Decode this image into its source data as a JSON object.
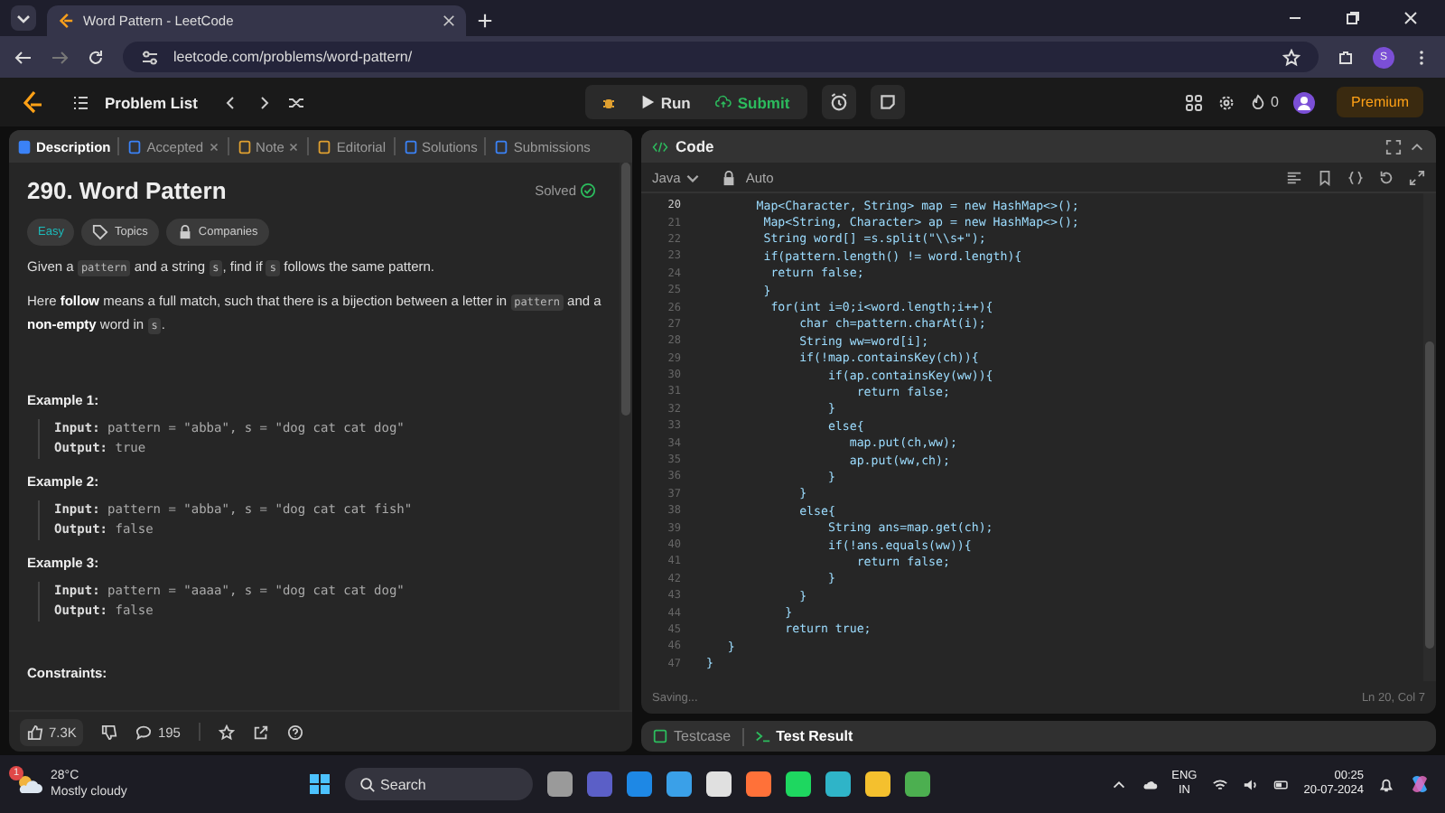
{
  "browser": {
    "tab_title": "Word Pattern - LeetCode",
    "url": "leetcode.com/problems/word-pattern/",
    "profile": "S"
  },
  "nav": {
    "problem_list": "Problem List",
    "run": "Run",
    "submit": "Submit",
    "streak": "0",
    "premium": "Premium"
  },
  "left_tabs": [
    {
      "label": "Description",
      "selected": true,
      "closable": false
    },
    {
      "label": "Accepted",
      "selected": false,
      "closable": true
    },
    {
      "label": "Note",
      "selected": false,
      "closable": true
    },
    {
      "label": "Editorial",
      "selected": false,
      "closable": false
    },
    {
      "label": "Solutions",
      "selected": false,
      "closable": false
    },
    {
      "label": "Submissions",
      "selected": false,
      "closable": false
    }
  ],
  "problem": {
    "title": "290. Word Pattern",
    "status": "Solved",
    "difficulty": "Easy",
    "tags": [
      "Topics",
      "Companies"
    ],
    "paragraphs": [
      [
        {
          "kind": "text",
          "text": "Given a "
        },
        {
          "kind": "code",
          "text": "pattern"
        },
        {
          "kind": "text",
          "text": " and a string "
        },
        {
          "kind": "code",
          "text": "s"
        },
        {
          "kind": "text",
          "text": ", find if "
        },
        {
          "kind": "code",
          "text": "s"
        },
        {
          "kind": "text",
          "text": " follows the same pattern."
        }
      ],
      [
        {
          "kind": "text",
          "text": "Here "
        },
        {
          "kind": "bold",
          "text": "follow"
        },
        {
          "kind": "text",
          "text": " means a full match, such that there is a bijection between a letter in "
        },
        {
          "kind": "code",
          "text": "pattern"
        },
        {
          "kind": "text",
          "text": " and a "
        },
        {
          "kind": "bold",
          "text": "non-empty"
        },
        {
          "kind": "text",
          "text": " word in "
        },
        {
          "kind": "code",
          "text": "s"
        },
        {
          "kind": "text",
          "text": "."
        }
      ]
    ],
    "examples": [
      {
        "title": "Example 1:",
        "lines": [
          {
            "label": "Input:",
            "value": "pattern = \"abba\", s = \"dog cat cat dog\""
          },
          {
            "label": "Output:",
            "value": "true"
          }
        ]
      },
      {
        "title": "Example 2:",
        "lines": [
          {
            "label": "Input:",
            "value": "pattern = \"abba\", s = \"dog cat cat fish\""
          },
          {
            "label": "Output:",
            "value": "false"
          }
        ]
      },
      {
        "title": "Example 3:",
        "lines": [
          {
            "label": "Input:",
            "value": "pattern = \"aaaa\", s = \"dog cat cat dog\""
          },
          {
            "label": "Output:",
            "value": "false"
          }
        ]
      }
    ],
    "constraints_title": "Constraints:",
    "likes": "7.3K",
    "comments": "195"
  },
  "editor": {
    "title": "Code",
    "language": "Java",
    "mode": "Auto",
    "status": "Saving...",
    "cursor": "Ln 20, Col 7",
    "lines": [
      {
        "n": "20",
        "text": "        Map<Character, String> map = new HashMap<>();"
      },
      {
        "n": "21",
        "text": "         Map<String, Character> ap = new HashMap<>();"
      },
      {
        "n": "22",
        "text": "         String word[] =s.split(\"\\\\s+\");"
      },
      {
        "n": "23",
        "text": "         if(pattern.length() != word.length){"
      },
      {
        "n": "24",
        "text": "          return false;"
      },
      {
        "n": "25",
        "text": "         }"
      },
      {
        "n": "26",
        "text": "          for(int i=0;i<word.length;i++){"
      },
      {
        "n": "27",
        "text": "              char ch=pattern.charAt(i);"
      },
      {
        "n": "28",
        "text": "              String ww=word[i];"
      },
      {
        "n": "29",
        "text": "              if(!map.containsKey(ch)){"
      },
      {
        "n": "30",
        "text": "                  if(ap.containsKey(ww)){"
      },
      {
        "n": "31",
        "text": "                      return false;"
      },
      {
        "n": "32",
        "text": "                  }"
      },
      {
        "n": "33",
        "text": "                  else{"
      },
      {
        "n": "34",
        "text": "                     map.put(ch,ww);"
      },
      {
        "n": "35",
        "text": "                     ap.put(ww,ch);"
      },
      {
        "n": "36",
        "text": "                  }"
      },
      {
        "n": "37",
        "text": "              }"
      },
      {
        "n": "38",
        "text": "              else{"
      },
      {
        "n": "39",
        "text": "                  String ans=map.get(ch);"
      },
      {
        "n": "40",
        "text": "                  if(!ans.equals(ww)){"
      },
      {
        "n": "41",
        "text": "                      return false;"
      },
      {
        "n": "42",
        "text": "                  }"
      },
      {
        "n": "43",
        "text": "              }"
      },
      {
        "n": "44",
        "text": "            }"
      },
      {
        "n": "45",
        "text": "            return true;"
      },
      {
        "n": "46",
        "text": "    }"
      },
      {
        "n": "47",
        "text": " }"
      }
    ]
  },
  "bottom_tabs": [
    {
      "label": "Testcase",
      "selected": false
    },
    {
      "label": "Test Result",
      "selected": true
    }
  ],
  "taskbar": {
    "weather_temp": "28°C",
    "weather_text": "Mostly cloudy",
    "weather_badge": "1",
    "search": "Search",
    "apps": [
      {
        "color": "#9a9a9a"
      },
      {
        "color": "#5b5fc7"
      },
      {
        "color": "#1e88e5"
      },
      {
        "color": "#3aa0e8"
      },
      {
        "color": "#e0e0e0"
      },
      {
        "color": "#ff7139"
      },
      {
        "color": "#1ed760"
      },
      {
        "color": "#2fb4c8"
      },
      {
        "color": "#f4c02e"
      },
      {
        "color": "#4caf50"
      }
    ],
    "language": "ENG",
    "region": "IN",
    "time": "00:25",
    "date": "20-07-2024"
  }
}
